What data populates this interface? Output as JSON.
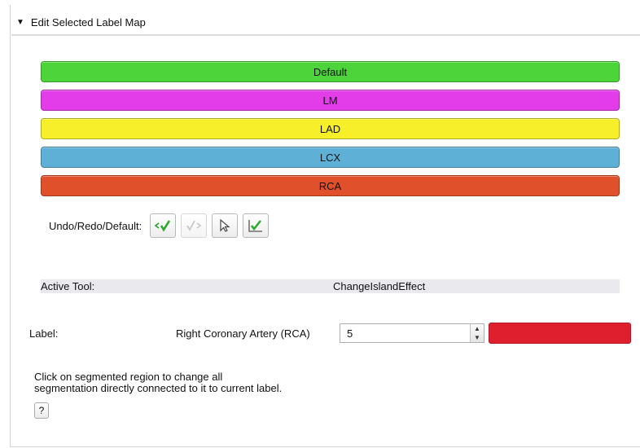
{
  "section": {
    "title": "Edit Selected Label Map"
  },
  "labels": [
    {
      "name": "Default",
      "color": "#4cd43a"
    },
    {
      "name": "LM",
      "color": "#e23de8"
    },
    {
      "name": "LAD",
      "color": "#f7ef2a"
    },
    {
      "name": "LCX",
      "color": "#5fb0d6"
    },
    {
      "name": "RCA",
      "color": "#e0502a"
    }
  ],
  "undo_redo": {
    "label": "Undo/Redo/Default:"
  },
  "active_tool": {
    "label": "Active Tool:",
    "value": "ChangeIslandEffect"
  },
  "label_row": {
    "label": "Label:",
    "name": "Right Coronary Artery (RCA)",
    "value": "5",
    "color": "#e01f2e"
  },
  "help": {
    "line1": "Click on segmented region to change all",
    "line2": "segmentation directly connected to it to current label.",
    "button": "?"
  }
}
